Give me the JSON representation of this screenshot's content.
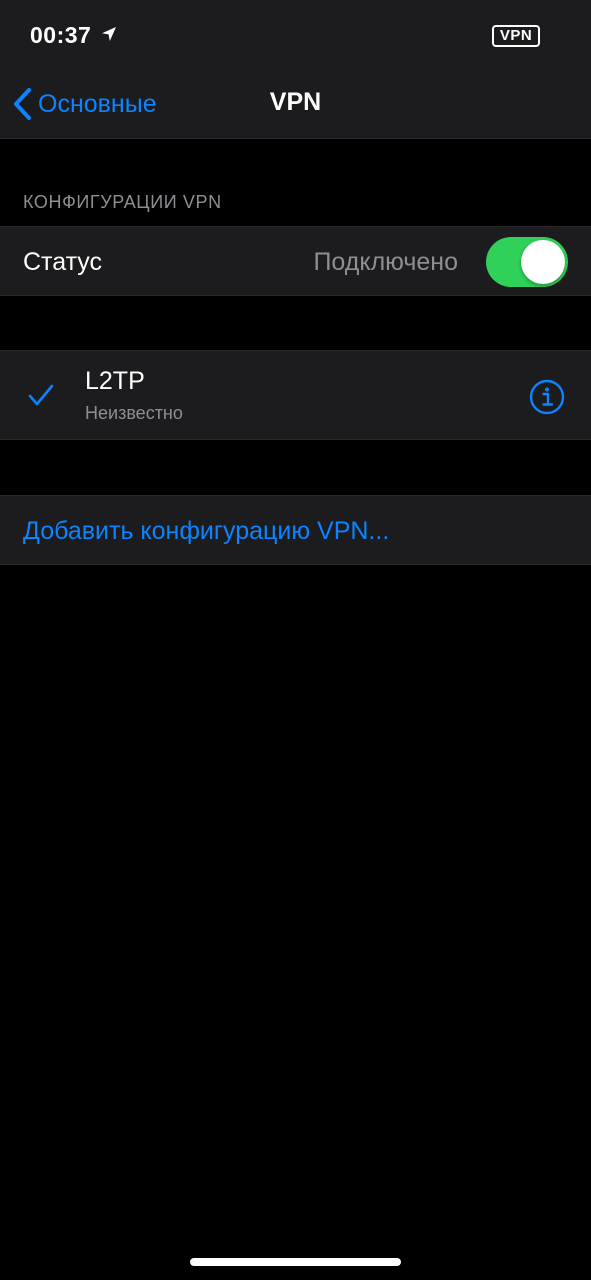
{
  "status_bar": {
    "time": "00:37",
    "location_icon": "location-arrow-icon",
    "vpn_badge": "VPN"
  },
  "nav": {
    "back_label": "Основные",
    "back_icon": "chevron-left-icon",
    "title": "VPN"
  },
  "section": {
    "header": "КОНФИГУРАЦИИ VPN"
  },
  "status_row": {
    "label": "Статус",
    "value": "Подключено",
    "toggle_on": true,
    "toggle_color": "#30d158"
  },
  "vpn_config": {
    "name": "L2TP",
    "status": "Неизвестно",
    "selected": true,
    "check_icon": "checkmark-icon",
    "info_icon": "info-circle-icon"
  },
  "add_config": {
    "label": "Добавить конфигурацию VPN..."
  },
  "colors": {
    "accent": "#0a84ff",
    "background": "#000000",
    "cell": "#1c1c1e",
    "secondary_text": "#8e8e93"
  }
}
